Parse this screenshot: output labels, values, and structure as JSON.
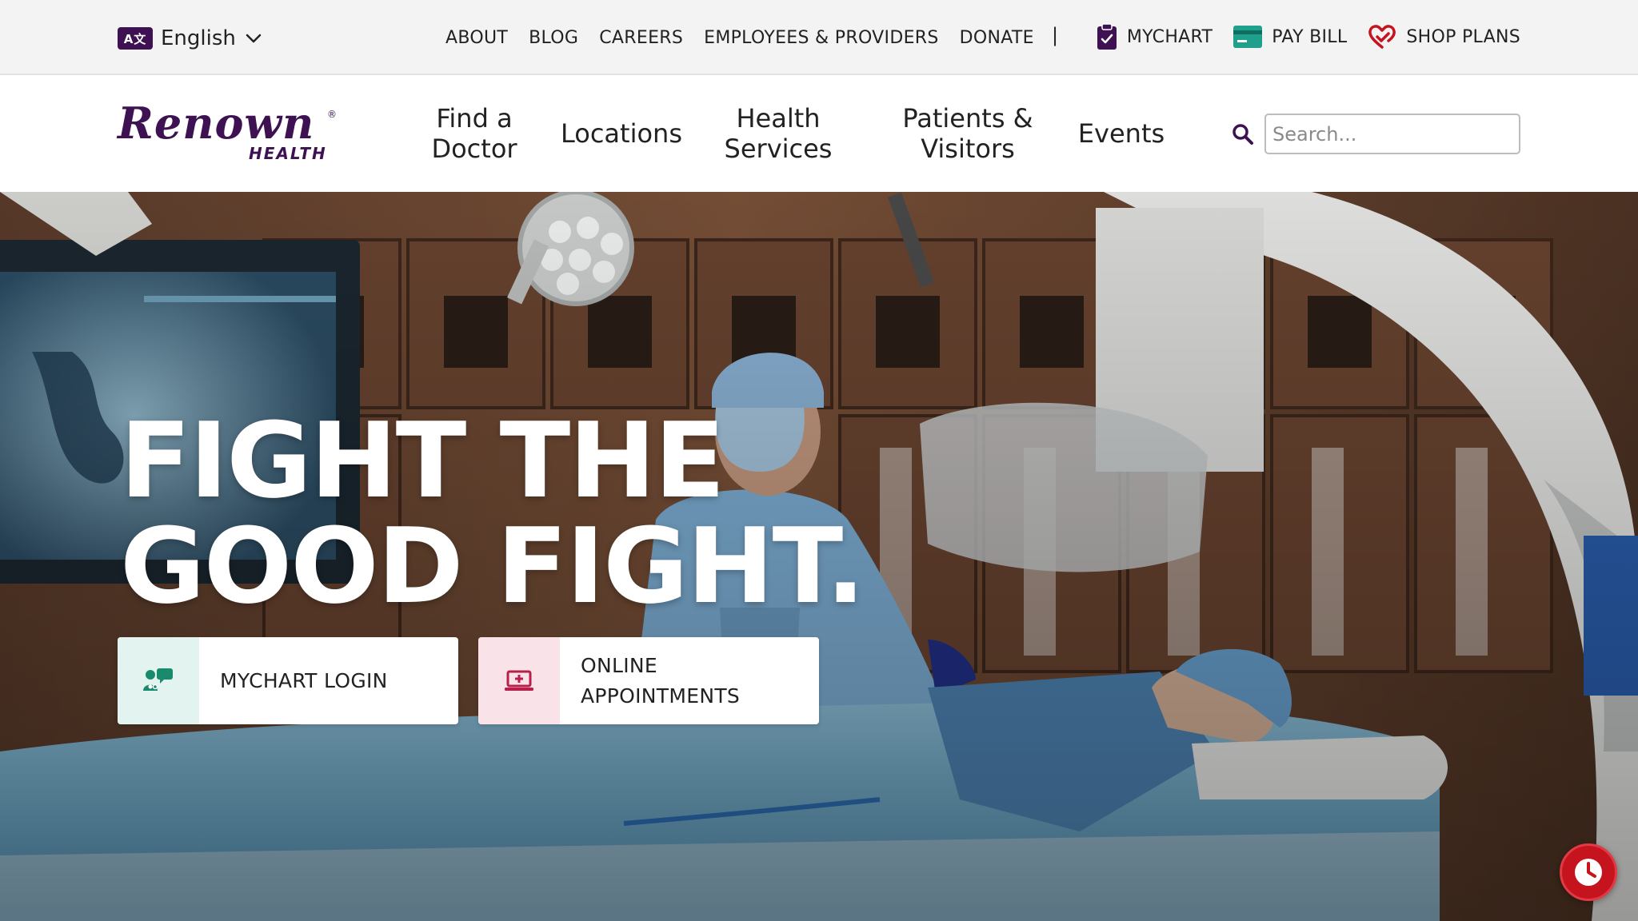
{
  "utility_bar": {
    "language": {
      "icon": "translate-icon",
      "icon_text": "A文",
      "label": "English",
      "chevron": "chevron-down-icon"
    },
    "links": [
      "ABOUT",
      "BLOG",
      "CAREERS",
      "EMPLOYEES & PROVIDERS",
      "DONATE"
    ],
    "separator": "|",
    "actions": [
      {
        "label": "MYCHART",
        "icon": "clipboard-icon"
      },
      {
        "label": "PAY BILL",
        "icon": "credit-card-icon"
      },
      {
        "label": "SHOP PLANS",
        "icon": "heart-icon"
      }
    ]
  },
  "header": {
    "logo": {
      "name": "Renown",
      "registered": "®",
      "sub": "HEALTH"
    },
    "nav": {
      "find_doctor": {
        "line1": "Find a",
        "line2": "Doctor"
      },
      "locations": "Locations",
      "health_services": {
        "line1": "Health",
        "line2": "Services"
      },
      "patients_visitors": {
        "line1": "Patients &",
        "line2": "Visitors"
      },
      "events": "Events"
    },
    "search": {
      "placeholder": "Search...",
      "icon": "search-icon"
    }
  },
  "hero": {
    "title_line1": "FIGHT THE",
    "title_line2": "GOOD FIGHT.",
    "ctas": {
      "mychart": {
        "label": "MYCHART LOGIN",
        "icon": "chat-users-icon"
      },
      "appointments": {
        "line1": "ONLINE",
        "line2": "APPOINTMENTS",
        "icon": "laptop-plus-icon"
      }
    }
  },
  "floating": {
    "icon": "clock-icon"
  },
  "colors": {
    "brand_purple": "#3d1152",
    "mychart_green": "#1a8a6e",
    "paybill_teal": "#1fa08c",
    "heart_red": "#c6141f",
    "clock_red": "#c6141f",
    "appt_pink": "#b8204a",
    "utility_bg": "#f3f3f3"
  }
}
